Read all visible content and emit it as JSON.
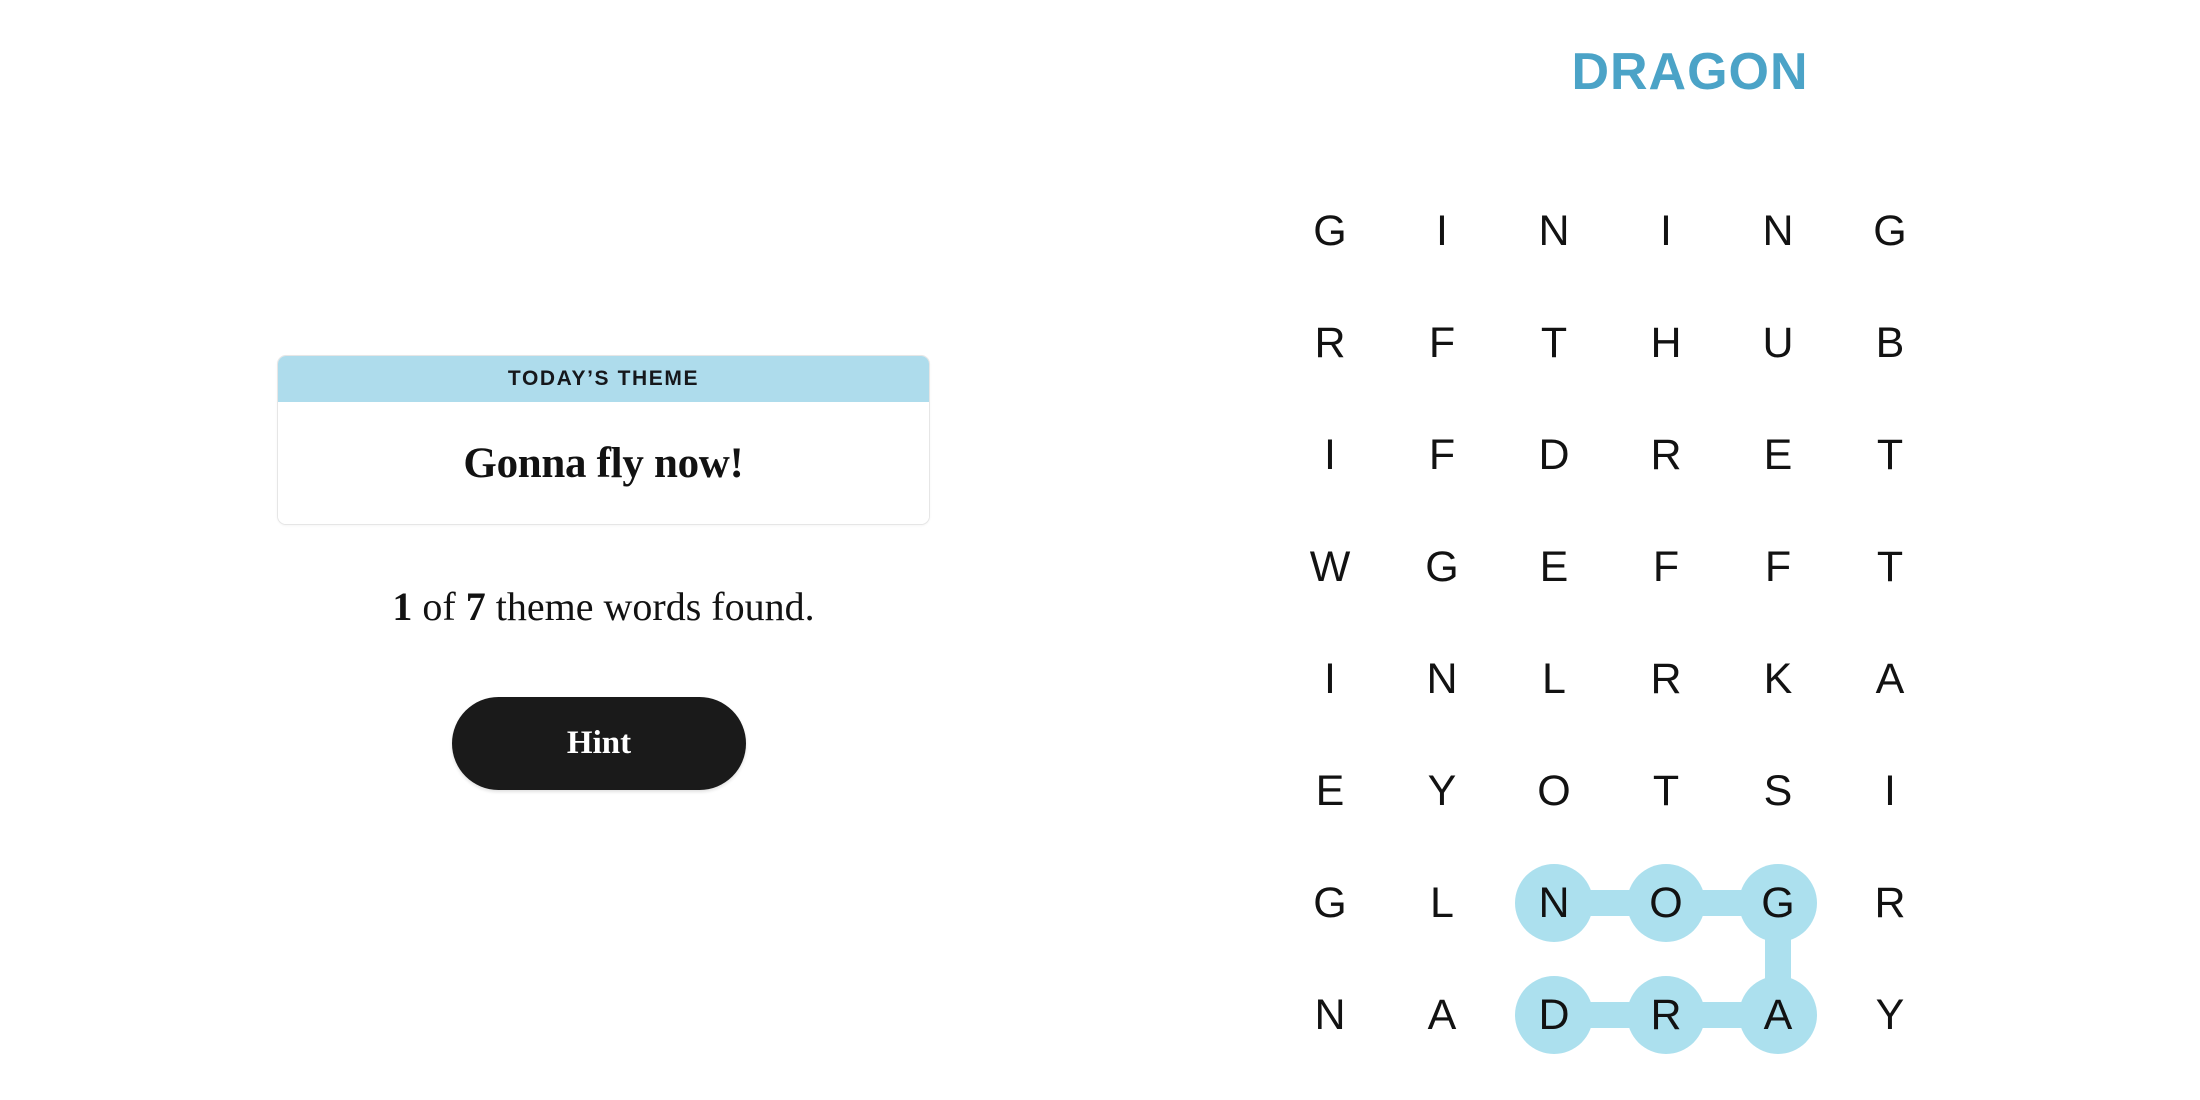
{
  "puzzle": {
    "title": "DRAGON",
    "accent_color": "#4ba3c7",
    "highlight_color": "#ace0ee",
    "rows": 8,
    "cols": 6,
    "letters": [
      [
        "G",
        "I",
        "N",
        "I",
        "N",
        "G"
      ],
      [
        "R",
        "F",
        "T",
        "H",
        "U",
        "B"
      ],
      [
        "I",
        "F",
        "D",
        "R",
        "E",
        "T"
      ],
      [
        "W",
        "G",
        "E",
        "F",
        "F",
        "T"
      ],
      [
        "I",
        "N",
        "L",
        "R",
        "K",
        "A"
      ],
      [
        "E",
        "Y",
        "O",
        "T",
        "S",
        "I"
      ],
      [
        "G",
        "L",
        "N",
        "O",
        "G",
        "R"
      ],
      [
        "N",
        "A",
        "D",
        "R",
        "A",
        "Y"
      ]
    ],
    "found_word_path": [
      {
        "row": 7,
        "col": 2,
        "letter": "D"
      },
      {
        "row": 7,
        "col": 3,
        "letter": "R"
      },
      {
        "row": 7,
        "col": 4,
        "letter": "A"
      },
      {
        "row": 6,
        "col": 4,
        "letter": "G"
      },
      {
        "row": 6,
        "col": 3,
        "letter": "O"
      },
      {
        "row": 6,
        "col": 2,
        "letter": "N"
      }
    ]
  },
  "theme_card": {
    "header_label": "TODAY’S THEME",
    "title": "Gonna fly now!",
    "header_color": "#aedcec"
  },
  "progress": {
    "found_count": "1",
    "of_label": "of",
    "total_count": "7",
    "suffix": "theme words found."
  },
  "hint": {
    "label": "Hint"
  }
}
